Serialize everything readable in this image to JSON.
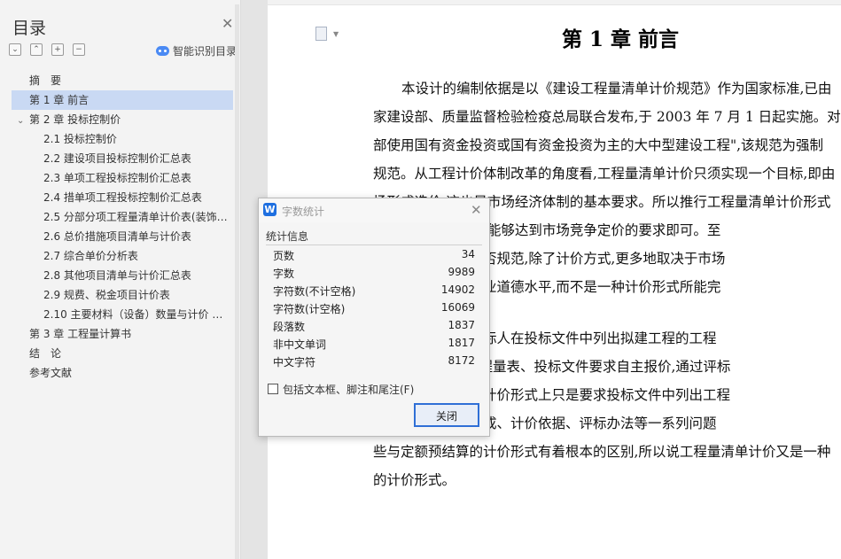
{
  "toc": {
    "title": "目录",
    "smart_label": "智能识别目录",
    "tool_icons": [
      "collapse-all-icon",
      "expand-all-icon",
      "add-level-icon",
      "remove-level-icon"
    ],
    "items": [
      {
        "label": "摘　要",
        "level": 1
      },
      {
        "label": "第 1 章  前言",
        "level": 1,
        "active": true
      },
      {
        "label": "第 2 章  投标控制价",
        "level": 1,
        "expanded": true
      },
      {
        "label": "2.1 投标控制价",
        "level": 2
      },
      {
        "label": "2.2 建设项目投标控制价汇总表",
        "level": 2
      },
      {
        "label": "2.3 单项工程投标控制价汇总表",
        "level": 2
      },
      {
        "label": "2.4 措单项工程投标控制价汇总表",
        "level": 2
      },
      {
        "label": "2.5 分部分项工程量清单计价表(装饰…",
        "level": 2
      },
      {
        "label": "2.6 总价措施项目清单与计价表",
        "level": 2
      },
      {
        "label": "2.7 综合单价分析表",
        "level": 2
      },
      {
        "label": "2.8  其他项目清单与计价汇总表",
        "level": 2
      },
      {
        "label": "2.9  规费、税金项目计价表",
        "level": 2
      },
      {
        "label": "2.10  主要材料（设备）数量与计价 …",
        "level": 2
      },
      {
        "label": "第 3 章  工程量计算书",
        "level": 1
      },
      {
        "label": "结　论",
        "level": 1
      },
      {
        "label": "参考文献",
        "level": 1
      }
    ]
  },
  "document": {
    "chapter_title": "第 1 章  前言",
    "lines": [
      "本设计的编制依据是以《建设工程量清单计价规范》作为国家标准,已由",
      "家建设部、质量监督检验检疫总局联合发布,于 2003 年 7 月 1 日起实施。对于",
      "部使用国有资金投资或国有资金投资为主的大中型建设工程\",该规范为强制",
      "规范。从工程计价体制改革的角度看,工程量清单计价只须实现一个目标,即由",
      "场形成造价,这也是市场经济体制的基本要求。所以推行工程量清单计价形式",
      "的意义,只要指出它能够达到市场竞争定价的要求即可。至",
      "筑市场经济秩序是否规范,除了计价方式,更多地取决于市场",
      "管部门的政策、职业道德水平,而不是一种计价形式所能完",
      "",
      "量清单计价就是投标人在投标文件中列出拟建工程的工程",
      "清单),投标人按工程量表、投标文件要求自主报价,通过评标",
      "形式。工程量清单计价形式上只是要求投标文件中列出工程",
      "程中涉及到造价构成、计价依据、评标办法等一系列问题",
      "些与定额预结算的计价形式有着根本的区别,所以说工程量清单计价又是一种",
      "的计价形式。"
    ]
  },
  "dialog": {
    "title": "字数统计",
    "section": "统计信息",
    "stats": [
      {
        "label": "页数",
        "value": "34"
      },
      {
        "label": "字数",
        "value": "9989"
      },
      {
        "label": "字符数(不计空格)",
        "value": "14902"
      },
      {
        "label": "字符数(计空格)",
        "value": "16069"
      },
      {
        "label": "段落数",
        "value": "1837"
      },
      {
        "label": "非中文单词",
        "value": "1817"
      },
      {
        "label": "中文字符",
        "value": "8172"
      }
    ],
    "checkbox_label": "包括文本框、脚注和尾注(F)",
    "checkbox_checked": false,
    "close_button": "关闭"
  },
  "colors": {
    "accent": "#2f6fd6",
    "toc_active": "#c9d9f3",
    "logo": "#1e6fe0"
  }
}
